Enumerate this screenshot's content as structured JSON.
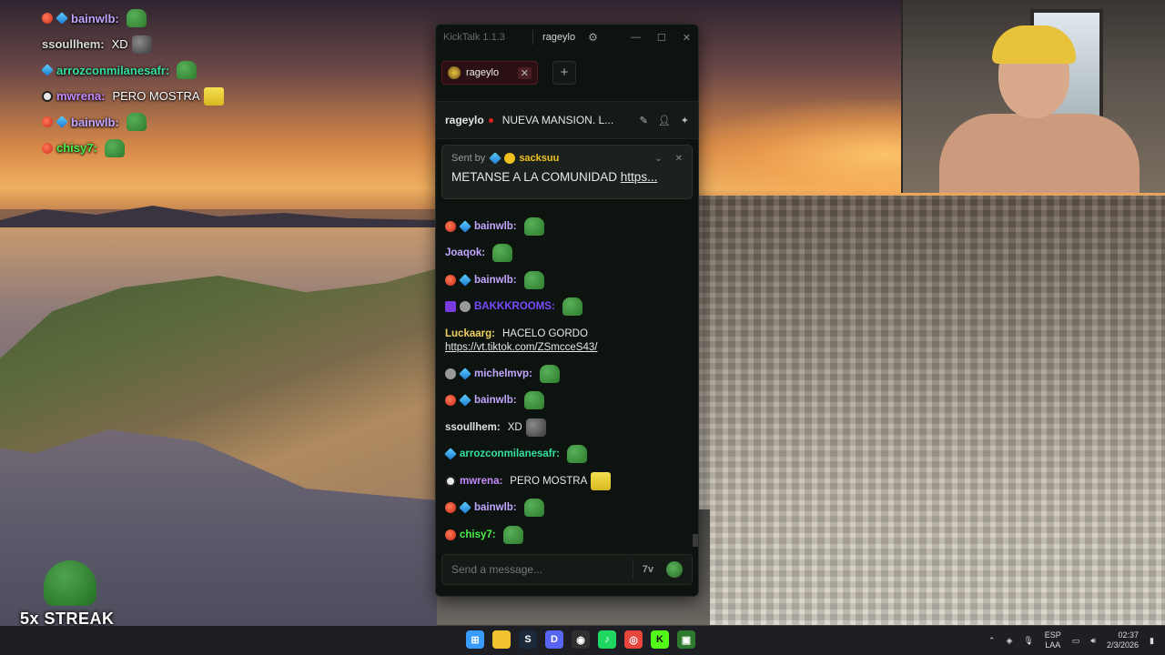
{
  "overlay_chat": [
    {
      "name": "bainwlb:",
      "name_color": "#c3a6ff",
      "badges": [
        "red",
        "cube"
      ],
      "text": "",
      "emote": "pepe"
    },
    {
      "name": "ssoullhem:",
      "name_color": "#dcdcdc",
      "badges": [],
      "text": "XD",
      "emote": "face"
    },
    {
      "name": "arrozconmilanesafr:",
      "name_color": "#35e0a0",
      "badges": [
        "cube"
      ],
      "text": "",
      "emote": "pepe"
    },
    {
      "name": "mwrena:",
      "name_color": "#c58bff",
      "badges": [
        "skull"
      ],
      "text": "PERO MOSTRA",
      "emote": "sponge"
    },
    {
      "name": "bainwlb:",
      "name_color": "#c3a6ff",
      "badges": [
        "red",
        "cube"
      ],
      "text": "",
      "emote": "pepe"
    },
    {
      "name": "chisy7:",
      "name_color": "#4cf04c",
      "badges": [
        "red"
      ],
      "text": "",
      "emote": "pepe"
    }
  ],
  "streak": {
    "label": "5x STREAK"
  },
  "kicktalk": {
    "app_name": "KickTalk 1.1.3",
    "user": "rageylo",
    "tab": {
      "label": "rageylo"
    },
    "stream": {
      "streamer": "rageylo",
      "title": "NUEVA MANSION. L..."
    },
    "pinned": {
      "sent_by_label": "Sent by",
      "sender": "sacksuu",
      "message": "METANSE A LA COMUNIDAD ",
      "link": "https..."
    },
    "messages": [
      {
        "name": "bainwlb:",
        "color": "#c3a6ff",
        "badges": [
          "red",
          "cube"
        ],
        "text": "",
        "emote": "pepe"
      },
      {
        "name": "Joaqok:",
        "color": "#c3a6ff",
        "badges": [],
        "text": "",
        "emote": "pepe"
      },
      {
        "name": "bainwlb:",
        "color": "#c3a6ff",
        "badges": [
          "red",
          "cube"
        ],
        "text": "",
        "emote": "pepe"
      },
      {
        "name": "BAKKKROOMS:",
        "color": "#7a4aff",
        "badges": [
          "purple",
          "gray"
        ],
        "text": "",
        "emote": "pepe"
      },
      {
        "name": "Luckaarg:",
        "color": "#f0d060",
        "badges": [],
        "text": "HACELO GORDO",
        "link": "https://vt.tiktok.com/ZSmcceS43/",
        "emote": ""
      },
      {
        "name": "michelmvp:",
        "color": "#c3a6ff",
        "badges": [
          "gray",
          "cube"
        ],
        "text": "",
        "emote": "pepe"
      },
      {
        "name": "bainwlb:",
        "color": "#c3a6ff",
        "badges": [
          "red",
          "cube"
        ],
        "text": "",
        "emote": "pepe"
      },
      {
        "name": "ssoullhem:",
        "color": "#e0e0e0",
        "badges": [],
        "text": "XD",
        "emote": "face"
      },
      {
        "name": "arrozconmilanesafr:",
        "color": "#35e0a0",
        "badges": [
          "cube"
        ],
        "text": "",
        "emote": "pepe"
      },
      {
        "name": "mwrena:",
        "color": "#c58bff",
        "badges": [
          "skull"
        ],
        "text": "PERO MOSTRA",
        "emote": "sponge"
      },
      {
        "name": "bainwlb:",
        "color": "#c3a6ff",
        "badges": [
          "red",
          "cube"
        ],
        "text": "",
        "emote": "pepe"
      },
      {
        "name": "chisy7:",
        "color": "#4cf04c",
        "badges": [
          "red"
        ],
        "text": "",
        "emote": "pepe"
      }
    ],
    "input": {
      "placeholder": "Send a message...",
      "icon_label": "7v"
    }
  },
  "taskbar": {
    "icons": [
      {
        "name": "windows-start-icon",
        "color": "#3a9bff",
        "glyph": "⊞"
      },
      {
        "name": "file-explorer-icon",
        "color": "#f2c230",
        "glyph": ""
      },
      {
        "name": "steam-icon",
        "color": "#1b2a3a",
        "glyph": "S"
      },
      {
        "name": "discord-icon",
        "color": "#5865f2",
        "glyph": "D"
      },
      {
        "name": "obs-icon",
        "color": "#303030",
        "glyph": "◉"
      },
      {
        "name": "spotify-icon",
        "color": "#1ed760",
        "glyph": "♪"
      },
      {
        "name": "chrome-icon",
        "color": "#e8453c",
        "glyph": "◎"
      },
      {
        "name": "kick-icon",
        "color": "#53fc18",
        "glyph": "K"
      },
      {
        "name": "kicktalk-icon",
        "color": "#2e7a2e",
        "glyph": "▣"
      }
    ],
    "lang_top": "ESP",
    "lang_bottom": "LAA",
    "time": "02:37",
    "date": "2/3/2026"
  }
}
